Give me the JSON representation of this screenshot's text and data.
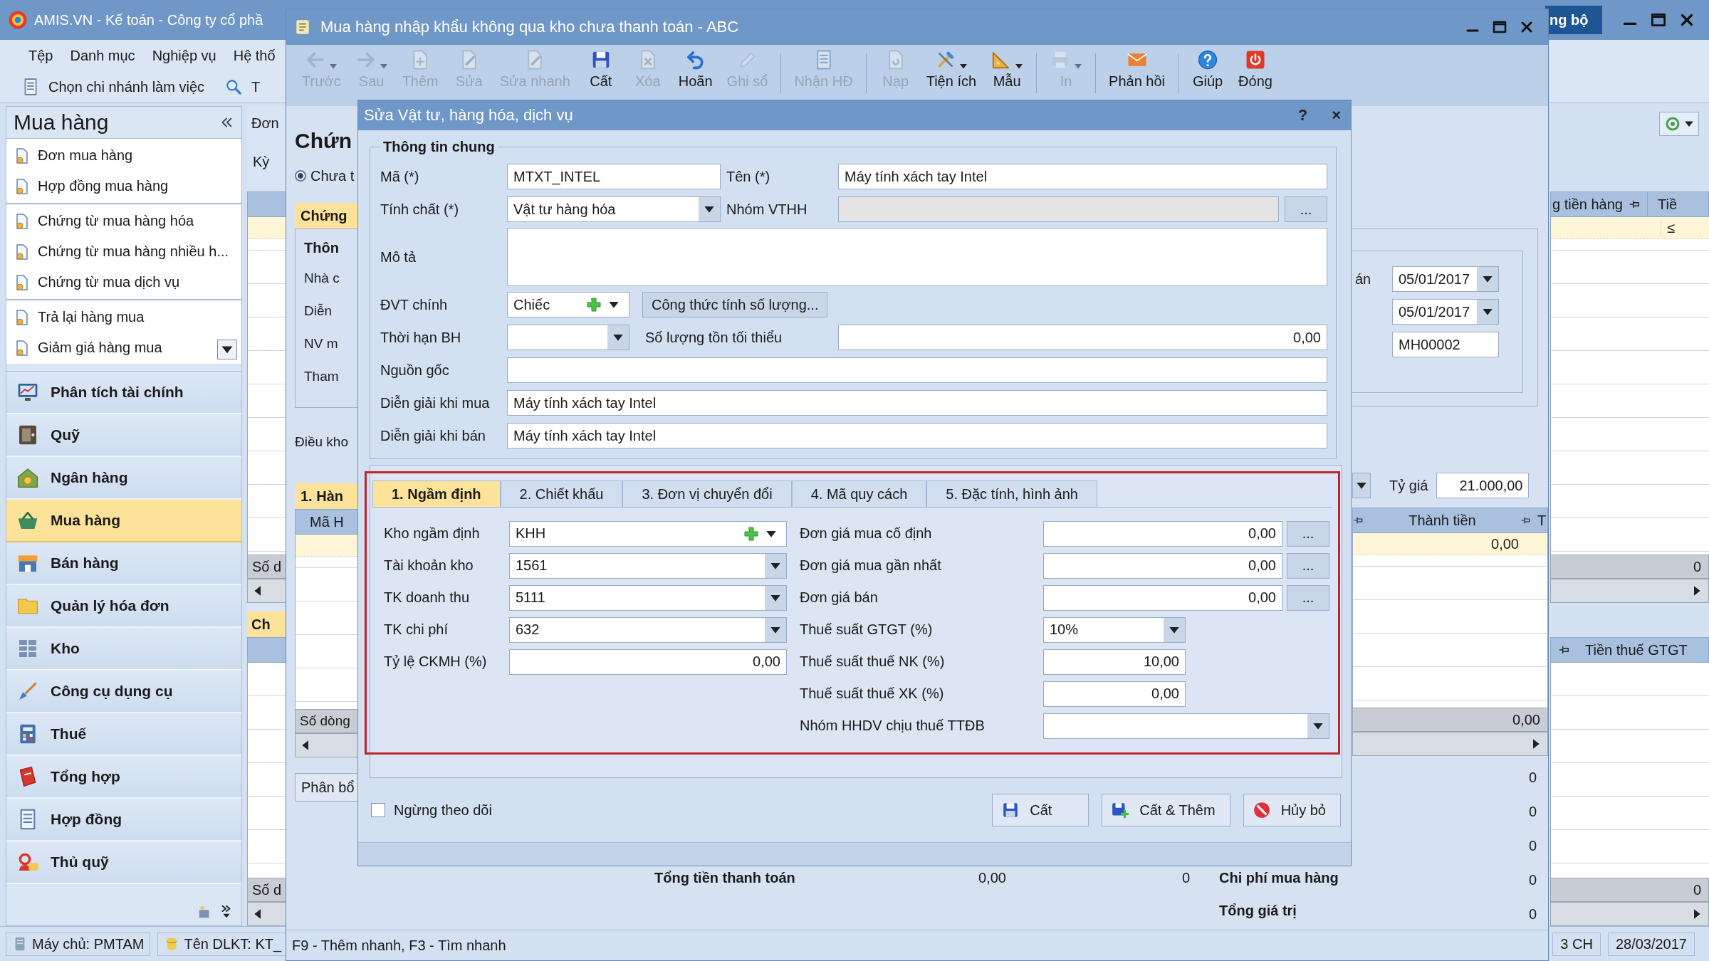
{
  "main_window": {
    "title": "AMIS.VN - Kế toán - Công ty cổ phầ",
    "sync_button": "ng bộ",
    "menu": [
      "Tệp",
      "Danh mục",
      "Nghiệp vụ",
      "Hệ thố"
    ],
    "branch_button": "Chọn chi nhánh làm việc",
    "search_label": "T",
    "sidebar": {
      "title": "Mua hàng",
      "link_groups": [
        [
          "Đơn mua hàng",
          "Hợp đồng mua hàng"
        ],
        [
          "Chứng từ mua hàng hóa",
          "Chứng từ mua hàng nhiều h...",
          "Chứng từ mua dịch vụ"
        ],
        [
          "Trả lại hàng mua",
          "Giảm giá hàng mua"
        ]
      ],
      "modules": [
        {
          "label": "Phân tích tài chính",
          "selected": false
        },
        {
          "label": "Quỹ",
          "selected": false
        },
        {
          "label": "Ngân hàng",
          "selected": false
        },
        {
          "label": "Mua hàng",
          "selected": true
        },
        {
          "label": "Bán hàng",
          "selected": false
        },
        {
          "label": "Quản lý hóa đơn",
          "selected": false
        },
        {
          "label": "Kho",
          "selected": false
        },
        {
          "label": "Công cụ dụng cụ",
          "selected": false
        },
        {
          "label": "Thuế",
          "selected": false
        },
        {
          "label": "Tổng hợp",
          "selected": false
        },
        {
          "label": "Hợp đồng",
          "selected": false
        },
        {
          "label": "Thủ quỹ",
          "selected": false
        }
      ]
    },
    "left_strip": {
      "tab": "Đơn",
      "period": "Kỳ",
      "footer_1": "Số d",
      "tab_2": "Ch",
      "footer_2": "Số d"
    },
    "right_strip": {
      "column_1": "g tiền hàng",
      "column_2": "Tiề",
      "filter": "≤",
      "footer_1": "0",
      "column_3": "Tiền thuế GTGT",
      "footer_2": "0"
    },
    "status_bar": {
      "server": "Máy chủ: PMTAM",
      "database": "Tên DLKT: KT_",
      "time": "3 CH",
      "date": "28/03/2017"
    }
  },
  "purchase_window": {
    "title": "Mua hàng nhập khẩu không qua kho chưa thanh toán - ABC",
    "toolbar": [
      {
        "label": "Trước",
        "disabled": true,
        "dropdown": true
      },
      {
        "label": "Sau",
        "disabled": true,
        "dropdown": true
      },
      {
        "label": "Thêm",
        "disabled": true,
        "dropdown": false
      },
      {
        "label": "Sửa",
        "disabled": true,
        "dropdown": false
      },
      {
        "label": "Sửa nhanh",
        "disabled": true,
        "dropdown": false
      },
      {
        "label": "Cất",
        "disabled": false,
        "dropdown": false
      },
      {
        "label": "Xóa",
        "disabled": true,
        "dropdown": false
      },
      {
        "label": "Hoãn",
        "disabled": false,
        "dropdown": false
      },
      {
        "label": "Ghi sổ",
        "disabled": true,
        "dropdown": false
      },
      {
        "label": "Nhận HĐ",
        "disabled": true,
        "dropdown": false
      },
      {
        "label": "Nạp",
        "disabled": true,
        "dropdown": false
      },
      {
        "label": "Tiện ích",
        "disabled": false,
        "dropdown": true
      },
      {
        "label": "Mẫu",
        "disabled": false,
        "dropdown": true
      },
      {
        "label": "In",
        "disabled": true,
        "dropdown": true
      },
      {
        "label": "Phản hồi",
        "disabled": false,
        "dropdown": false
      },
      {
        "label": "Giúp",
        "disabled": false,
        "dropdown": false
      },
      {
        "label": "Đóng",
        "disabled": false,
        "dropdown": false
      }
    ],
    "heading": "Chứn",
    "radio": {
      "label": "Chưa t",
      "selected": true
    },
    "tab_1": "Chứng",
    "group_1": "Thôn",
    "labels": [
      "Nhà c",
      "Diễn",
      "NV m",
      "Tham"
    ],
    "terms_label": "Điều kho",
    "tab_2": "1. Hàn",
    "dates": [
      {
        "label": "án",
        "value": "05/01/2017"
      },
      {
        "value": "05/01/2017"
      }
    ],
    "voucher_no": "MH00002",
    "exchange_label": "Tỷ giá",
    "exchange_rate": "21.000,00",
    "grid": {
      "column_1": "Mã H",
      "column_2": "Thành tiền",
      "column_3": "T",
      "row_value": "0,00",
      "row_count_label": "Số dòng",
      "footer_value": "0,00"
    },
    "allocate_button": "Phân bổ",
    "summary_values": [
      "0",
      "0",
      "0",
      "0",
      "0"
    ],
    "totals": {
      "label_1": "Tổng tiền thanh toán",
      "value_1": "0,00",
      "value_2": "0",
      "label_2": "Chi phí mua hàng",
      "label_3": "Tổng giá trị"
    },
    "status_bar": "F9 - Thêm nhanh, F3 - Tìm nhanh"
  },
  "dialog": {
    "title": "Sửa Vật tư, hàng hóa, dịch vụ",
    "help": "?",
    "close": "×",
    "general": {
      "legend": "Thông tin chung",
      "code": {
        "label": "Mã (*)",
        "value": "MTXT_INTEL"
      },
      "name": {
        "label": "Tên (*)",
        "value": "Máy tính xách tay Intel"
      },
      "nature": {
        "label": "Tính chất (*)",
        "value": "Vật tư hàng hóa"
      },
      "group": {
        "label": "Nhóm VTHH",
        "button": "..."
      },
      "description": {
        "label": "Mô tả"
      },
      "unit": {
        "label": "ĐVT chính",
        "value": "Chiếc"
      },
      "formula_button": "Công thức tính số lượng...",
      "warranty": {
        "label": "Thời hạn BH"
      },
      "min_stock": {
        "label": "Số lượng tồn tối thiểu",
        "value": "0,00"
      },
      "origin": {
        "label": "Nguồn gốc"
      },
      "purchase_desc": {
        "label": "Diễn giải khi mua",
        "value": "Máy tính xách tay Intel"
      },
      "sale_desc": {
        "label": "Diễn giải khi bán",
        "value": "Máy tính xách tay Intel"
      }
    },
    "tabs": [
      {
        "label": "1. Ngầm định",
        "selected": true
      },
      {
        "label": "2. Chiết khấu",
        "selected": false
      },
      {
        "label": "3. Đơn vị chuyển đổi",
        "selected": false
      },
      {
        "label": "4. Mã quy cách",
        "selected": false
      },
      {
        "label": "5. Đặc tính, hình ảnh",
        "selected": false
      }
    ],
    "defaults_left": [
      {
        "label": "Kho ngầm định",
        "value": "KHH",
        "kind": "combo_add"
      },
      {
        "label": "Tài khoản kho",
        "value": "1561",
        "kind": "combo"
      },
      {
        "label": "TK doanh thu",
        "value": "5111",
        "kind": "combo"
      },
      {
        "label": "TK chi phí",
        "value": "632",
        "kind": "combo"
      },
      {
        "label": "Tỷ lệ CKMH (%)",
        "value": "0,00",
        "kind": "number"
      }
    ],
    "defaults_right": [
      {
        "label": "Đơn giá mua cố định",
        "value": "0,00",
        "kind": "lookup",
        "button": "..."
      },
      {
        "label": "Đơn giá mua gần nhất",
        "value": "0,00",
        "kind": "lookup",
        "button": "..."
      },
      {
        "label": "Đơn giá bán",
        "value": "0,00",
        "kind": "lookup",
        "button": "..."
      },
      {
        "label": "Thuế suất GTGT (%)",
        "value": "10%",
        "kind": "short_combo"
      },
      {
        "label": "Thuế suất thuế NK (%)",
        "value": "10,00",
        "kind": "short_number"
      },
      {
        "label": "Thuế suất thuế XK (%)",
        "value": "0,00",
        "kind": "short_number"
      },
      {
        "label": "Nhóm HHDV chịu thuế TTĐB",
        "kind": "wide_combo"
      }
    ],
    "stop_tracking": {
      "label": "Ngừng theo dõi",
      "checked": false
    },
    "buttons": [
      "Cất",
      "Cất & Thêm",
      "Hủy bỏ"
    ]
  }
}
